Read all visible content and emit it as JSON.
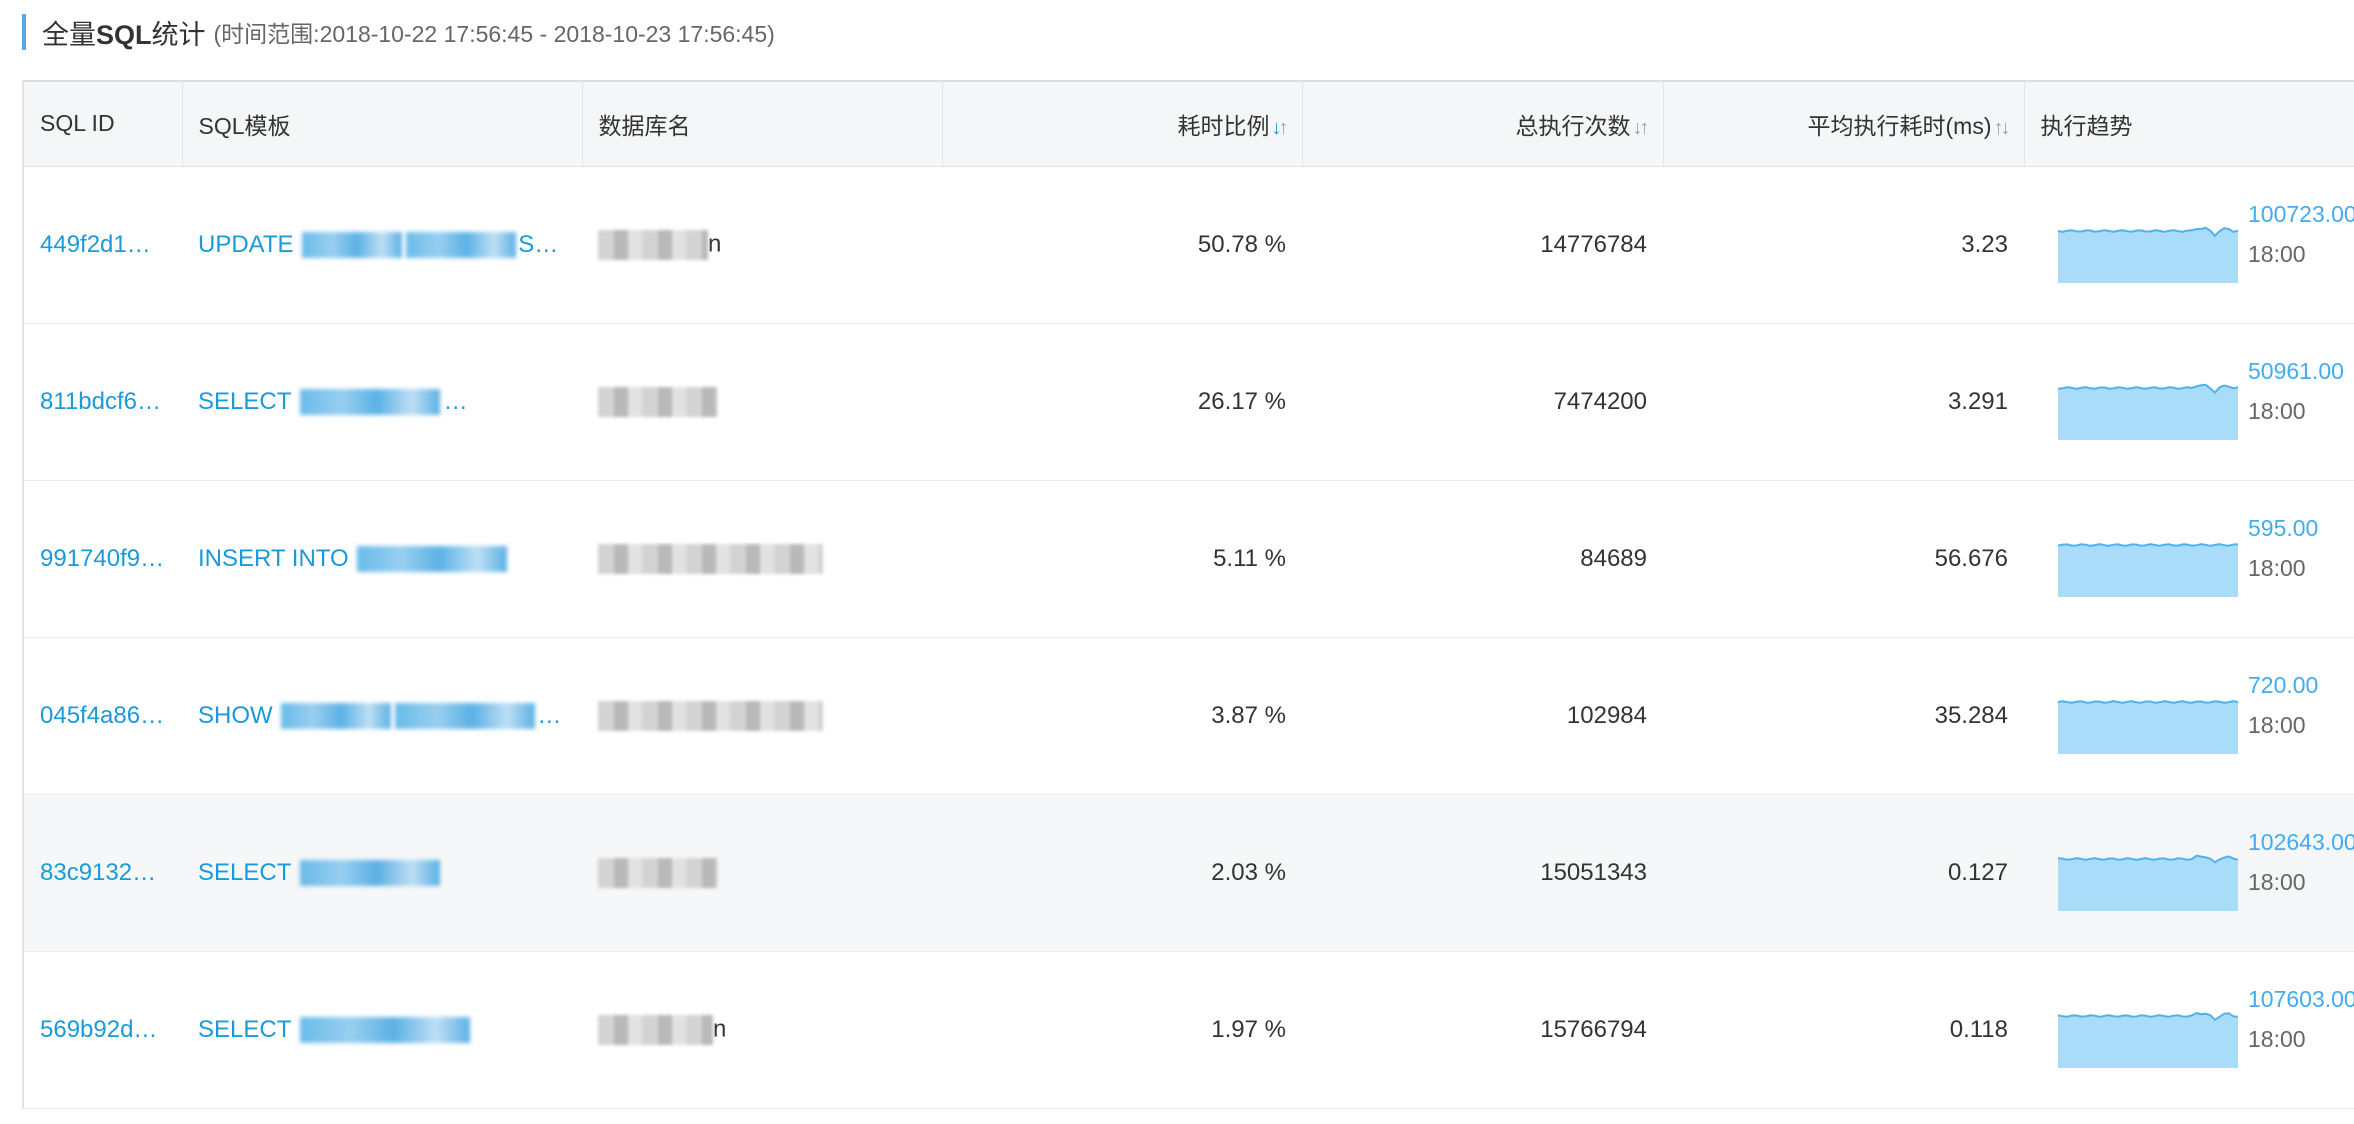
{
  "header": {
    "title_cn_prefix": "全量",
    "title_en": "SQL",
    "title_cn_suffix": "统计",
    "time_range_label": "(时间范围:2018-10-22 17:56:45 - 2018-10-23 17:56:45)"
  },
  "columns": {
    "sql_id": "SQL ID",
    "sql_template": "SQL模板",
    "database": "数据库名",
    "time_ratio": "耗时比例",
    "total_exec": "总执行次数",
    "avg_exec_time": "平均执行耗时(ms)",
    "trend": "执行趋势"
  },
  "colors": {
    "link": "#1a9ad9",
    "trend_fill": "#a9dcf8",
    "trend_line": "#4fb2ec"
  },
  "rows": [
    {
      "sql_id": "449f2d1…",
      "template_prefix": "UPDATE",
      "template_suffix": "SET la…",
      "db_visible_tail": "n",
      "time_ratio": "50.78 %",
      "total_exec": "14776784",
      "avg_time": "3.23",
      "trend_peak": "100723.00",
      "trend_time": "18:00",
      "alt": false
    },
    {
      "sql_id": "811bdcf6…",
      "template_prefix": "SELECT",
      "template_suffix": "…",
      "db_visible_tail": "",
      "time_ratio": "26.17 %",
      "total_exec": "7474200",
      "avg_time": "3.291",
      "trend_peak": "50961.00",
      "trend_time": "18:00",
      "alt": false
    },
    {
      "sql_id": "991740f9…",
      "template_prefix": "INSERT INTO",
      "template_suffix": "",
      "db_visible_tail": "",
      "time_ratio": "5.11 %",
      "total_exec": "84689",
      "avg_time": "56.676",
      "trend_peak": "595.00",
      "trend_time": "18:00",
      "alt": false
    },
    {
      "sql_id": "045f4a86…",
      "template_prefix": "SHOW",
      "template_suffix": "…",
      "db_visible_tail": "",
      "time_ratio": "3.87 %",
      "total_exec": "102984",
      "avg_time": "35.284",
      "trend_peak": "720.00",
      "trend_time": "18:00",
      "alt": false
    },
    {
      "sql_id": "83c9132…",
      "template_prefix": "SELECT",
      "template_suffix": "",
      "db_visible_tail": "",
      "time_ratio": "2.03 %",
      "total_exec": "15051343",
      "avg_time": "0.127",
      "trend_peak": "102643.00",
      "trend_time": "18:00",
      "alt": true
    },
    {
      "sql_id": "569b92d…",
      "template_prefix": "SELECT",
      "template_suffix": "",
      "db_visible_tail": "n",
      "time_ratio": "1.97 %",
      "total_exec": "15766794",
      "avg_time": "0.118",
      "trend_peak": "107603.00",
      "trend_time": "18:00",
      "alt": false
    }
  ]
}
